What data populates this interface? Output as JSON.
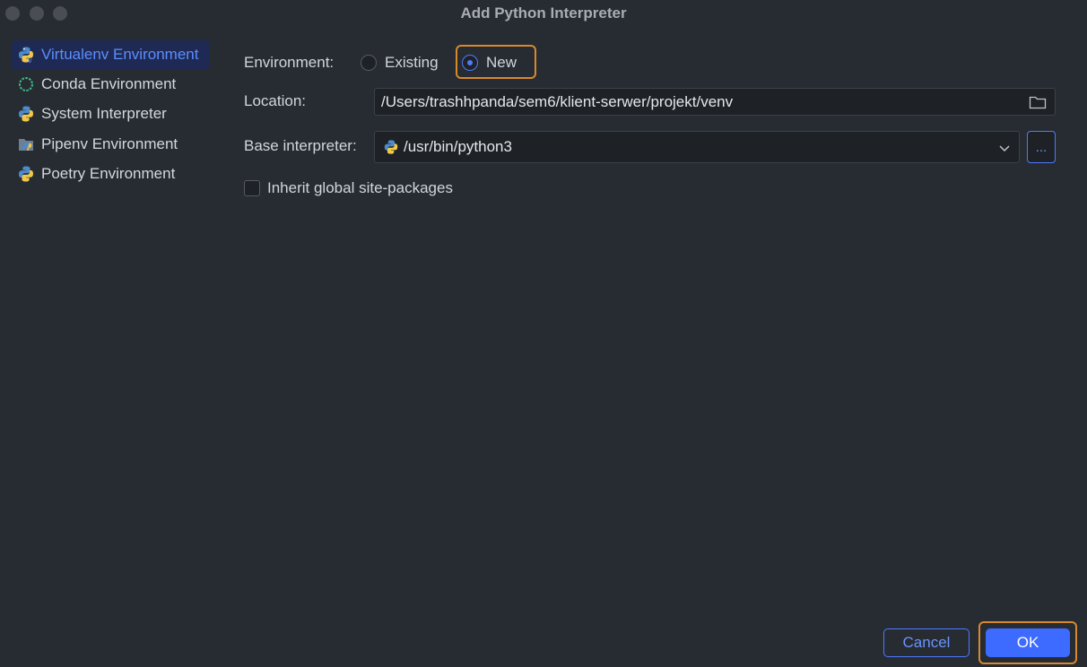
{
  "window": {
    "title": "Add Python Interpreter"
  },
  "sidebar": {
    "items": [
      {
        "label": "Virtualenv Environment",
        "icon": "python-venv-icon"
      },
      {
        "label": "Conda Environment",
        "icon": "conda-icon"
      },
      {
        "label": "System Interpreter",
        "icon": "python-icon"
      },
      {
        "label": "Pipenv Environment",
        "icon": "pipenv-icon"
      },
      {
        "label": "Poetry Environment",
        "icon": "poetry-icon"
      }
    ],
    "selected": "Virtualenv Environment"
  },
  "form": {
    "environment_label": "Environment:",
    "option_existing": "Existing",
    "option_new": "New",
    "selected_option": "New",
    "location_label": "Location:",
    "location_value": "/Users/trashhpanda/sem6/klient-serwer/projekt/venv",
    "base_label": "Base interpreter:",
    "base_value": "/usr/bin/python3",
    "browse_label": "...",
    "inherit_label": "Inherit global site-packages",
    "inherit_checked": false
  },
  "footer": {
    "cancel_label": "Cancel",
    "ok_label": "OK"
  },
  "colors": {
    "accent": "#3d6bff",
    "highlight": "#d9882d",
    "background": "#262c32",
    "selected_bg": "#1f2a54"
  }
}
